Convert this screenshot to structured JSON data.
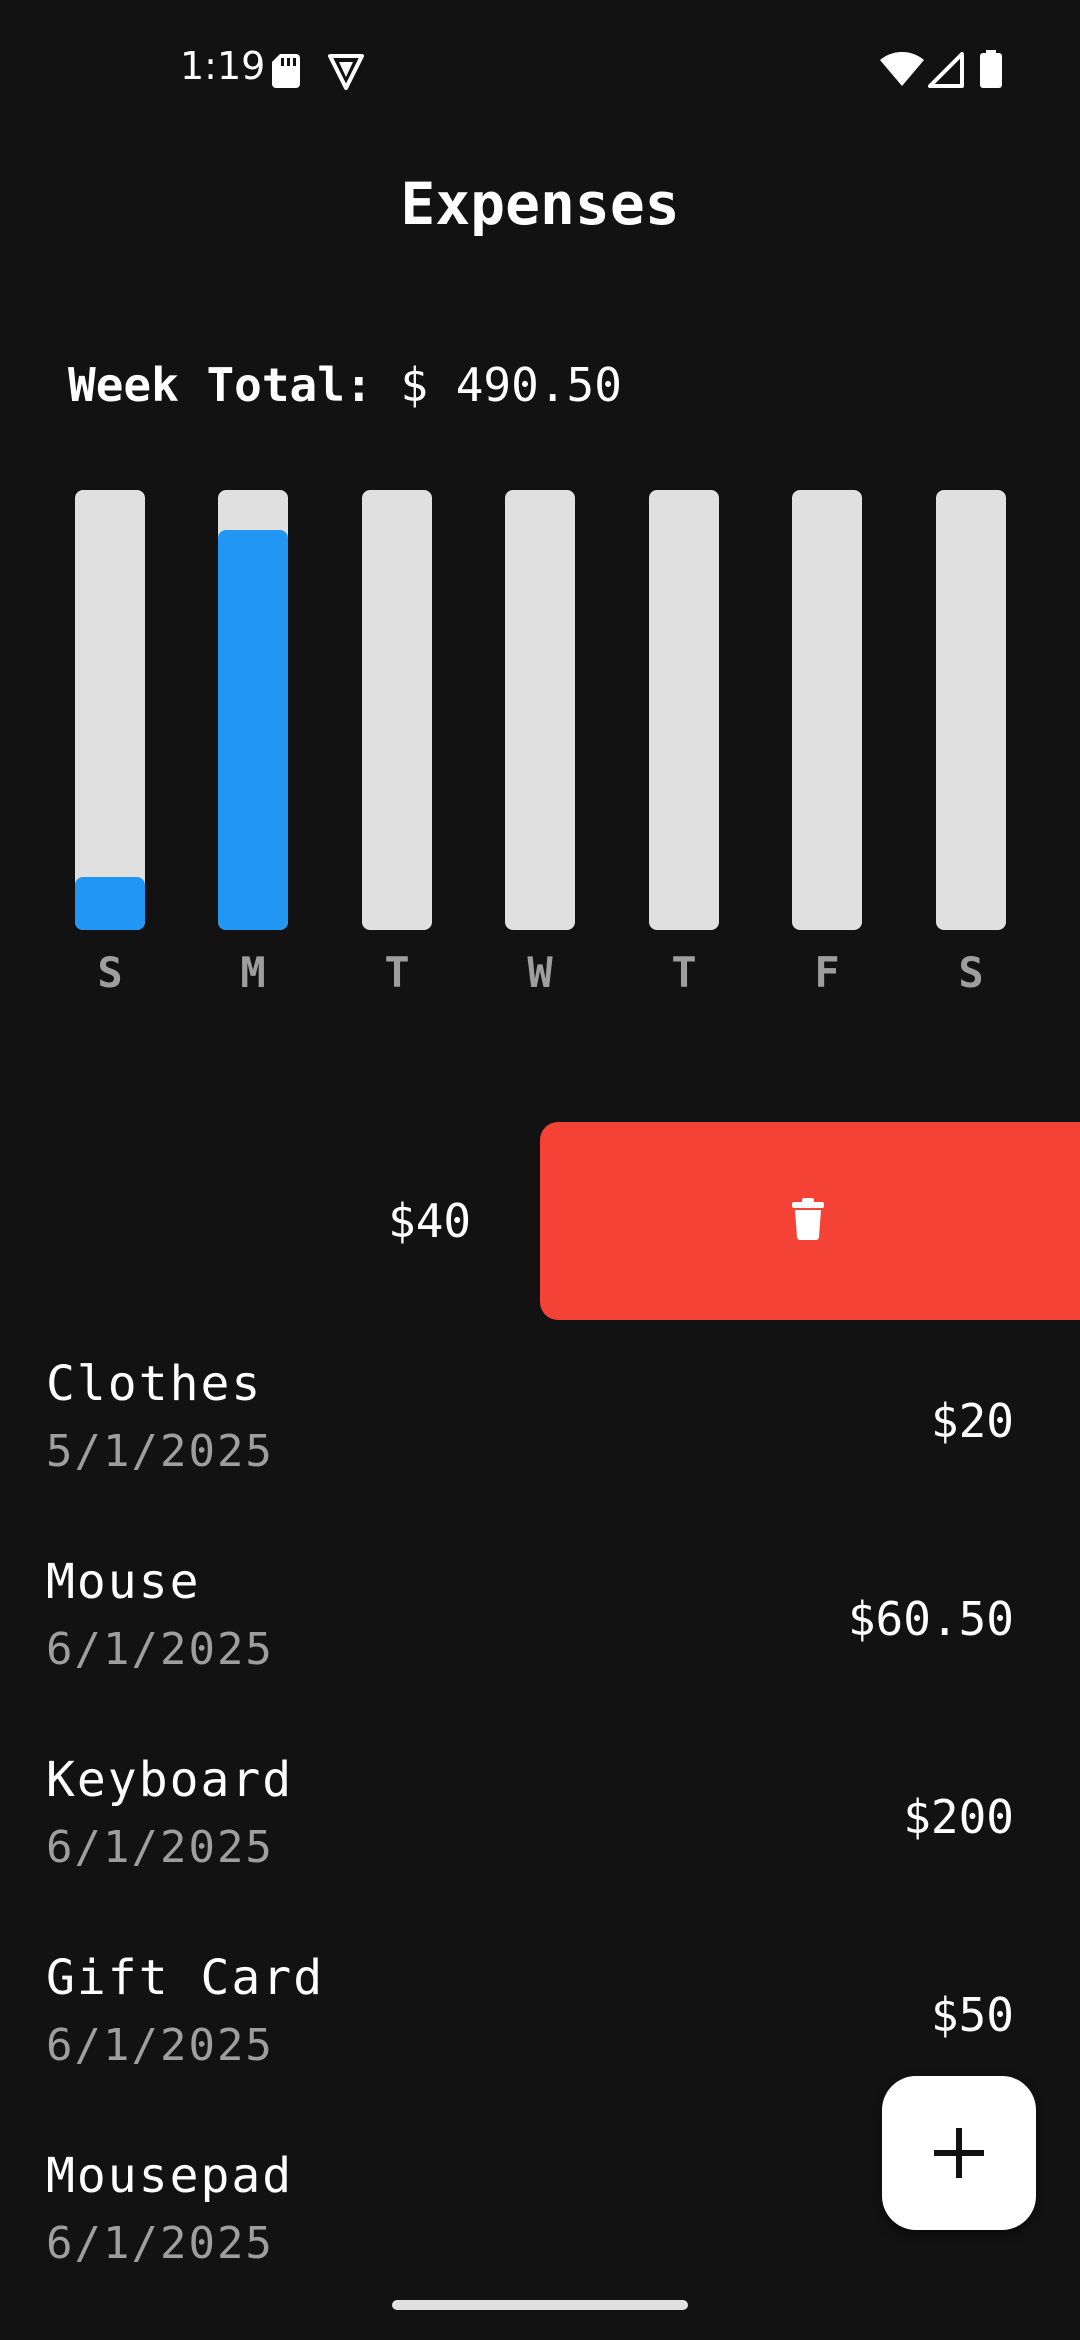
{
  "status_bar": {
    "time": "1:19"
  },
  "header": {
    "title": "Expenses"
  },
  "summary": {
    "week_total_label": "Week Total:",
    "week_total_value": "$ 490.50"
  },
  "chart_data": {
    "type": "bar",
    "categories": [
      "S",
      "M",
      "T",
      "W",
      "T",
      "F",
      "S"
    ],
    "values": [
      0.12,
      0.91,
      0,
      0,
      0,
      0,
      0
    ],
    "fill_color": "#2196f3",
    "track_color": "#e0e0e0"
  },
  "swiped_item": {
    "amount": "$40",
    "delete_color": "#f44336"
  },
  "expenses": [
    {
      "name": "Clothes",
      "date": "5/1/2025",
      "amount": "$20"
    },
    {
      "name": "Mouse",
      "date": "6/1/2025",
      "amount": "$60.50"
    },
    {
      "name": "Keyboard",
      "date": "6/1/2025",
      "amount": "$200"
    },
    {
      "name": "Gift Card",
      "date": "6/1/2025",
      "amount": "$50"
    },
    {
      "name": "Mousepad",
      "date": "6/1/2025",
      "amount": ""
    }
  ],
  "icons": {
    "fab": "plus-icon",
    "delete": "trash-icon"
  }
}
